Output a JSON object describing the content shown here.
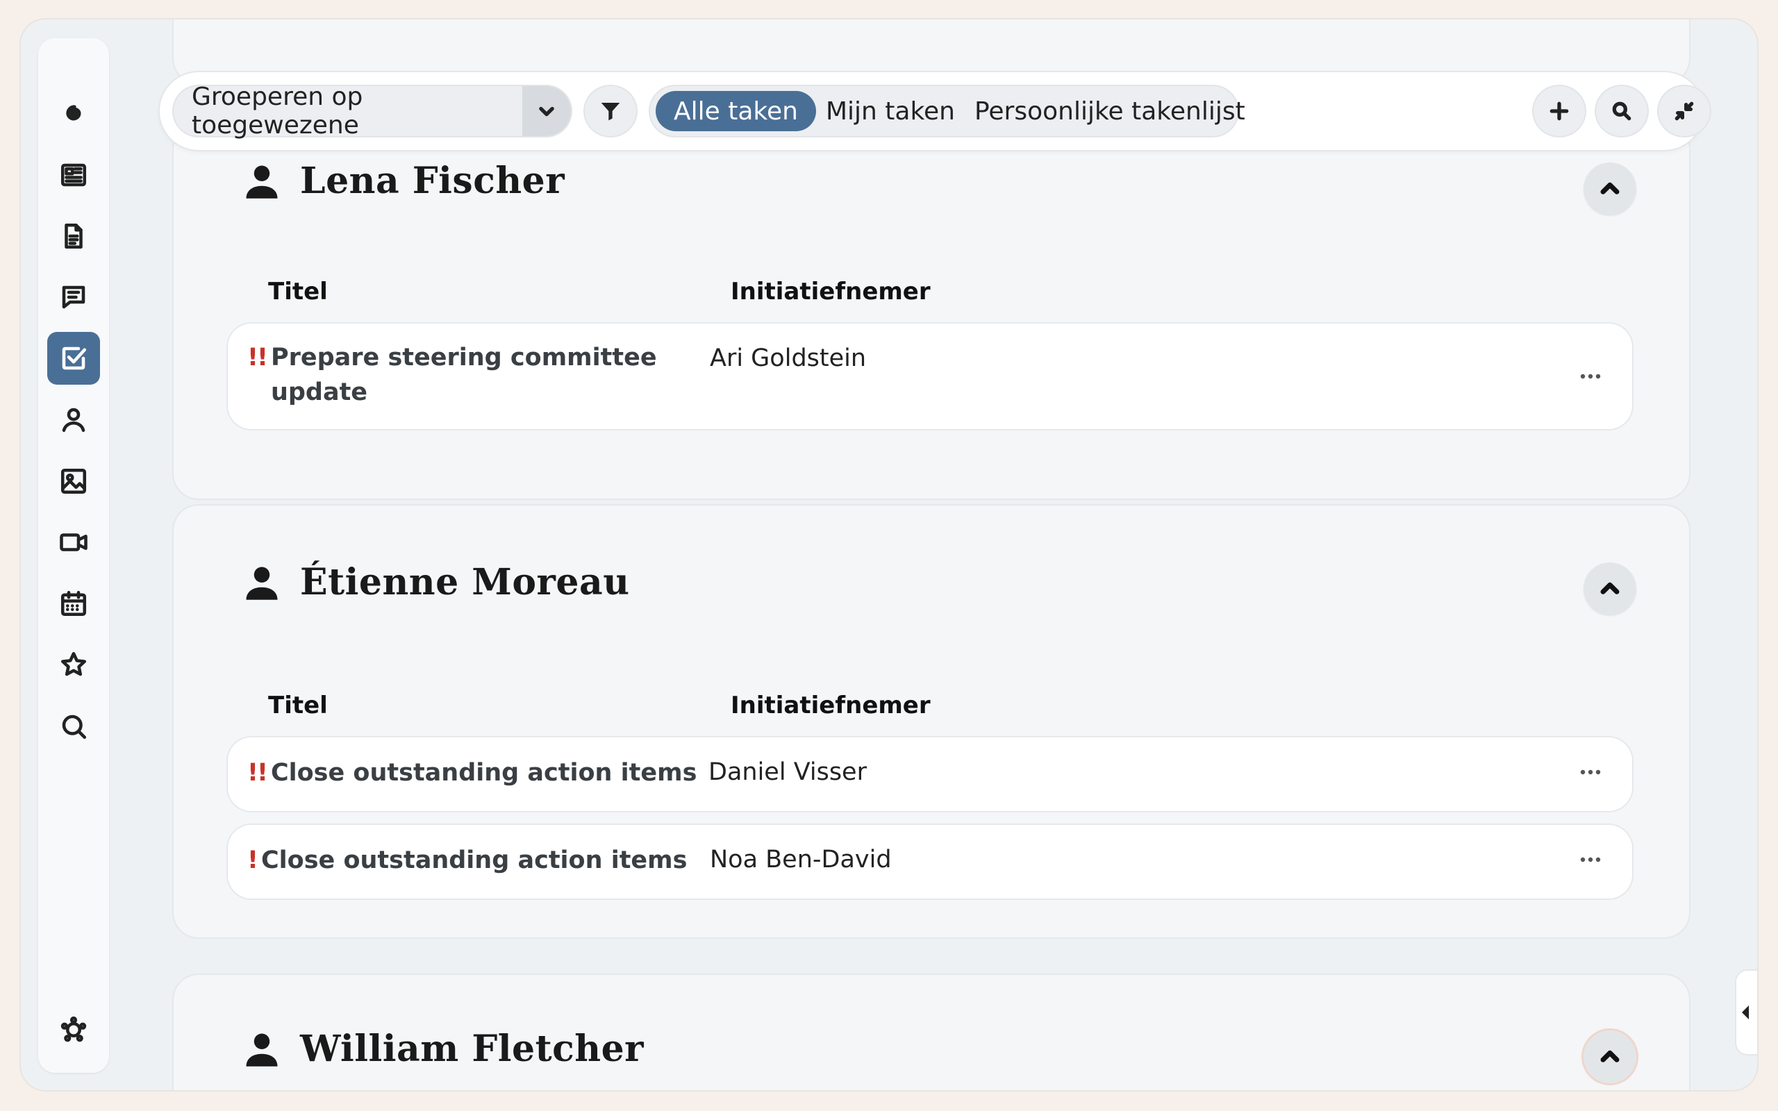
{
  "toolbar": {
    "group_by_label": "Groeperen op toegewezene",
    "segments": [
      "Alle taken",
      "Mijn taken",
      "Persoonlijke takenlijst"
    ],
    "active_segment": "Alle taken"
  },
  "columns": {
    "title": "Titel",
    "initiator": "Initiatiefnemer"
  },
  "groups": [
    {
      "name": "Lena Fischer",
      "tasks": [
        {
          "priority": "!!",
          "title": "Prepare steering committee update",
          "initiator": "Ari Goldstein"
        }
      ]
    },
    {
      "name": "Étienne Moreau",
      "tasks": [
        {
          "priority": "!!",
          "title": "Close outstanding action items",
          "initiator": "Daniel Visser"
        },
        {
          "priority": "!",
          "title": "Close outstanding action items",
          "initiator": "Noa Ben-David"
        }
      ]
    },
    {
      "name": "William Fletcher",
      "tasks": []
    }
  ],
  "icons": {
    "sidebar": [
      "spiral-logo-icon",
      "newspaper-icon",
      "document-icon",
      "chat-icon",
      "tasks-icon",
      "user-icon",
      "image-icon",
      "video-icon",
      "calendar-icon",
      "star-icon",
      "search-icon",
      "settings-icon"
    ],
    "active_sidebar": "tasks-icon"
  },
  "colors": {
    "accent": "#4a6f96",
    "priority": "#c8322a"
  }
}
